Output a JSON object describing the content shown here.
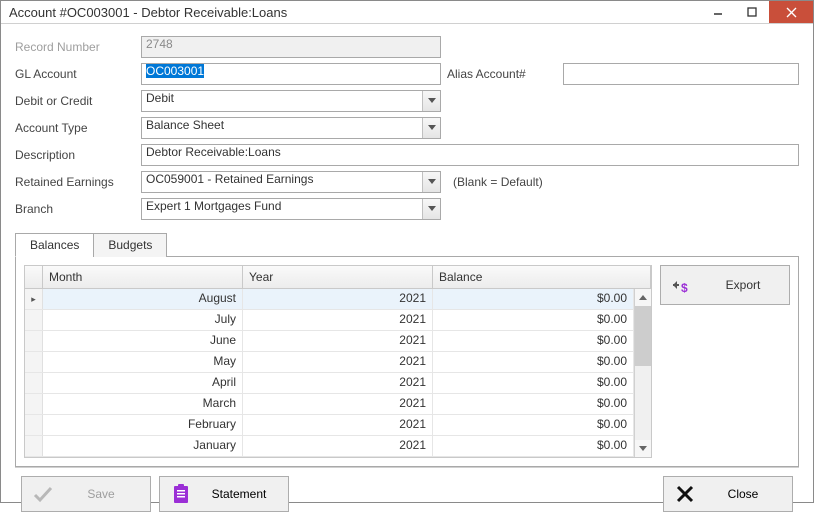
{
  "window": {
    "title": "Account #OC003001 - Debtor Receivable:Loans"
  },
  "form": {
    "record_label": "Record Number",
    "record_value": "2748",
    "gl_label": "GL Account",
    "gl_value": "OC003001",
    "alias_label": "Alias Account#",
    "alias_value": "",
    "debit_label": "Debit or Credit",
    "debit_value": "Debit",
    "type_label": "Account Type",
    "type_value": "Balance Sheet",
    "desc_label": "Description",
    "desc_value": "Debtor Receivable:Loans",
    "retained_label": "Retained Earnings",
    "retained_value": "OC059001 - Retained Earnings",
    "retained_hint": "(Blank = Default)",
    "branch_label": "Branch",
    "branch_value": "Expert 1 Mortgages Fund"
  },
  "tabs": {
    "balances": "Balances",
    "budgets": "Budgets"
  },
  "grid": {
    "col_month": "Month",
    "col_year": "Year",
    "col_balance": "Balance",
    "rows": [
      {
        "month": "August",
        "year": "2021",
        "balance": "$0.00"
      },
      {
        "month": "July",
        "year": "2021",
        "balance": "$0.00"
      },
      {
        "month": "June",
        "year": "2021",
        "balance": "$0.00"
      },
      {
        "month": "May",
        "year": "2021",
        "balance": "$0.00"
      },
      {
        "month": "April",
        "year": "2021",
        "balance": "$0.00"
      },
      {
        "month": "March",
        "year": "2021",
        "balance": "$0.00"
      },
      {
        "month": "February",
        "year": "2021",
        "balance": "$0.00"
      },
      {
        "month": "January",
        "year": "2021",
        "balance": "$0.00"
      }
    ]
  },
  "buttons": {
    "export": "Export",
    "save": "Save",
    "statement": "Statement",
    "close": "Close"
  }
}
